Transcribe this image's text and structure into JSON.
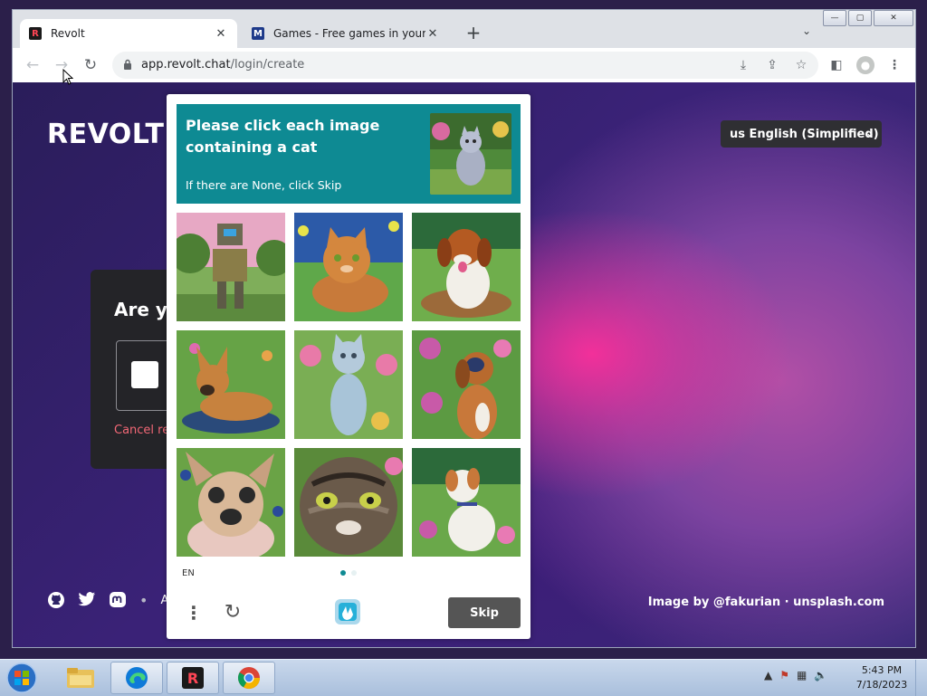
{
  "browser": {
    "tabs": [
      {
        "title": "Revolt",
        "icon": "revolt-favicon",
        "active": true
      },
      {
        "title": "Games - Free games in your brow",
        "icon": "msn-games-favicon",
        "active": false
      }
    ],
    "address": {
      "host": "app.revolt.chat",
      "path": "/login/create"
    }
  },
  "page": {
    "brand": "REVOLT",
    "language_select": "us English (Simplified)",
    "card": {
      "title": "Are yo",
      "link": "Cancel re"
    },
    "footer_cut": "A",
    "credit": "Image by @fakurian · unsplash.com"
  },
  "captcha": {
    "prompt": "Please click each image containing a cat",
    "subtext": "If there are None, click Skip",
    "reference_image": "cat-sitting-in-garden",
    "tiles": [
      "robot",
      "cat",
      "dog",
      "dog",
      "cat",
      "dog",
      "dog",
      "cat",
      "dog"
    ],
    "language": "EN",
    "pages": 2,
    "current_page": 1,
    "skip_label": "Skip",
    "accent": "#0e8a93"
  },
  "taskbar": {
    "pinned": [
      "file-explorer-icon",
      "edge-icon",
      "revolt-icon",
      "chrome-icon"
    ],
    "time": "5:43 PM",
    "date": "7/18/2023"
  }
}
